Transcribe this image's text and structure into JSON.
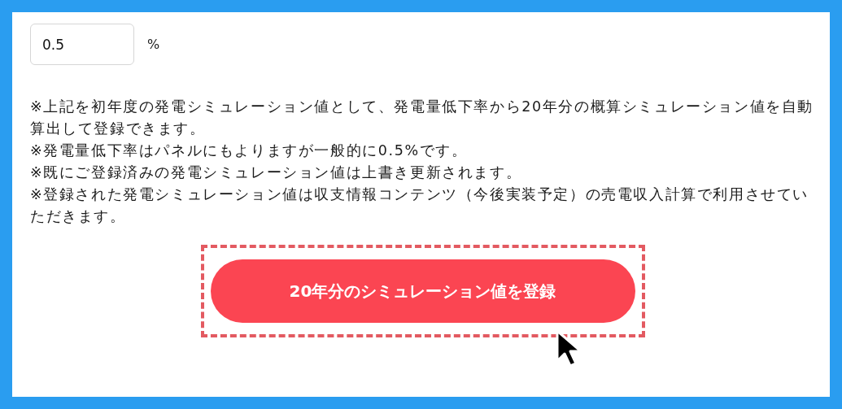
{
  "rate_field": {
    "value": "0.5",
    "unit": "%"
  },
  "notes": [
    "※上記を初年度の発電シミュレーション値として、発電量低下率から20年分の概算シミュレーション値を自動算出して登録できます。",
    "※発電量低下率はパネルにもよりますが一般的に0.5%です。",
    "※既にご登録済みの発電シミュレーション値は上書き更新されます。",
    "※登録された発電シミュレーション値は収支情報コンテンツ（今後実装予定）の売電収入計算で利用させていただきます。"
  ],
  "register_button": {
    "label": "20年分のシミュレーション値を登録",
    "highlighted": true
  }
}
